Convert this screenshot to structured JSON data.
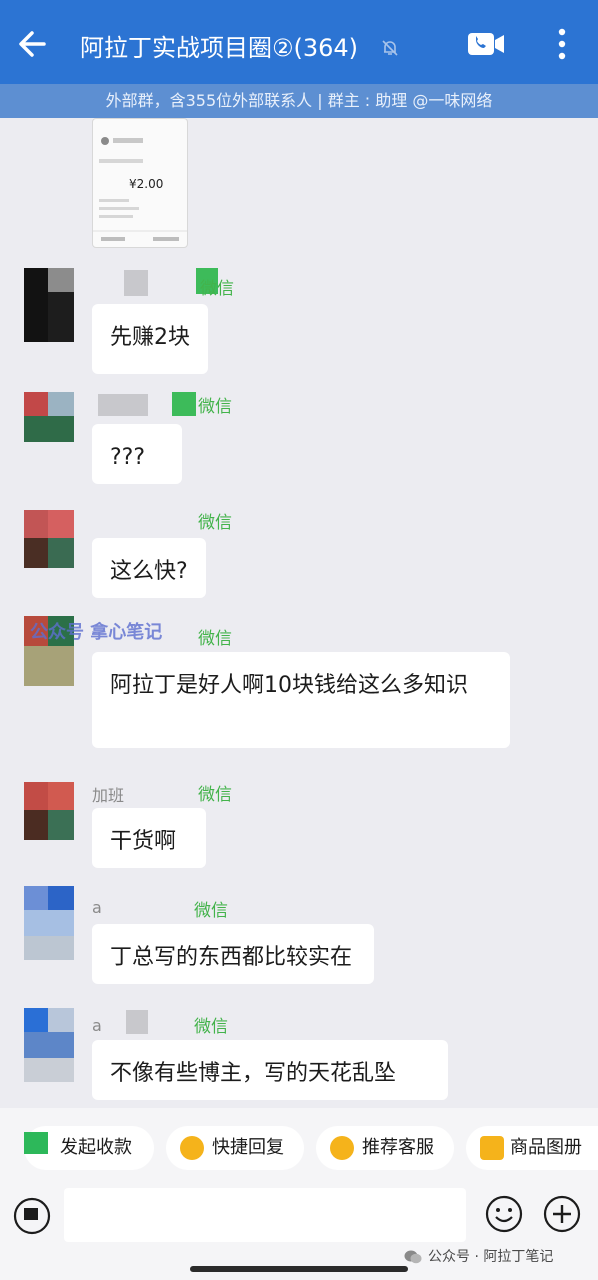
{
  "header": {
    "title": "阿拉丁实战项目圈②(364)",
    "subtitle": "外部群，含355位外部联系人 | 群主 : 助理 @一味网络",
    "icons": [
      "back-arrow-icon",
      "bell-off-icon",
      "video-call-icon",
      "more-vertical-icon"
    ]
  },
  "colors": {
    "header": "#2c74d3",
    "subbar": "#5d8fd2",
    "wechat_tag": "#43b34b",
    "chat_bg": "#ececf1"
  },
  "receipt_preview": {
    "amount": "¥2.00"
  },
  "messages": [
    {
      "sender": "",
      "tag": "微信",
      "text": "先赚2块"
    },
    {
      "sender": "",
      "tag": "微信",
      "text": "???"
    },
    {
      "sender": "",
      "tag": "微信",
      "text": "这么快?"
    },
    {
      "sender": "",
      "tag": "微信",
      "text": "阿拉丁是好人啊10块钱给这么多知识"
    },
    {
      "sender": "加班",
      "tag": "微信",
      "text": "干货啊"
    },
    {
      "sender": "a",
      "tag": "微信",
      "text": "丁总写的东西都比较实在"
    },
    {
      "sender": "a",
      "tag": "微信",
      "text": "不像有些博主，写的天花乱坠"
    }
  ],
  "overlay_watermark": "公众号 拿心笔记",
  "quick_actions": [
    "发起收款",
    "快捷回复",
    "推荐客服",
    "商品图册"
  ],
  "footer_watermark": "公众号 · 阿拉丁笔记"
}
